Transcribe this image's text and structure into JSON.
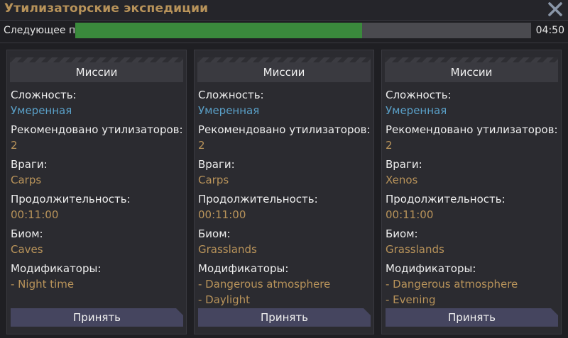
{
  "window": {
    "title": "Утилизаторские экспедиции",
    "close_icon": "close-icon"
  },
  "progress": {
    "label": "Следующее п",
    "value_percent": 63,
    "time": "04:50",
    "fill_color": "#3a8a3c"
  },
  "labels": {
    "difficulty": "Сложность:",
    "recommended": "Рекомендовано утилизаторов:",
    "enemies": "Враги:",
    "duration": "Продолжительность:",
    "biome": "Биом:",
    "modifiers": "Модификаторы:"
  },
  "missions": [
    {
      "header": "Миссии",
      "difficulty": "Умеренная",
      "recommended": "2",
      "enemies": "Carps",
      "duration": "00:11:00",
      "biome": "Caves",
      "modifiers": [
        "- Night time"
      ],
      "accept_label": "Принять"
    },
    {
      "header": "Миссии",
      "difficulty": "Умеренная",
      "recommended": "2",
      "enemies": "Carps",
      "duration": "00:11:00",
      "biome": "Grasslands",
      "modifiers": [
        "- Dangerous atmosphere",
        "- Daylight"
      ],
      "accept_label": "Принять"
    },
    {
      "header": "Миссии",
      "difficulty": "Умеренная",
      "recommended": "2",
      "enemies": "Xenos",
      "duration": "00:11:00",
      "biome": "Grasslands",
      "modifiers": [
        "- Dangerous atmosphere",
        "- Evening"
      ],
      "accept_label": "Принять"
    }
  ],
  "colors": {
    "accent_gold": "#b8935a",
    "difficulty_blue": "#5aa0c8"
  }
}
